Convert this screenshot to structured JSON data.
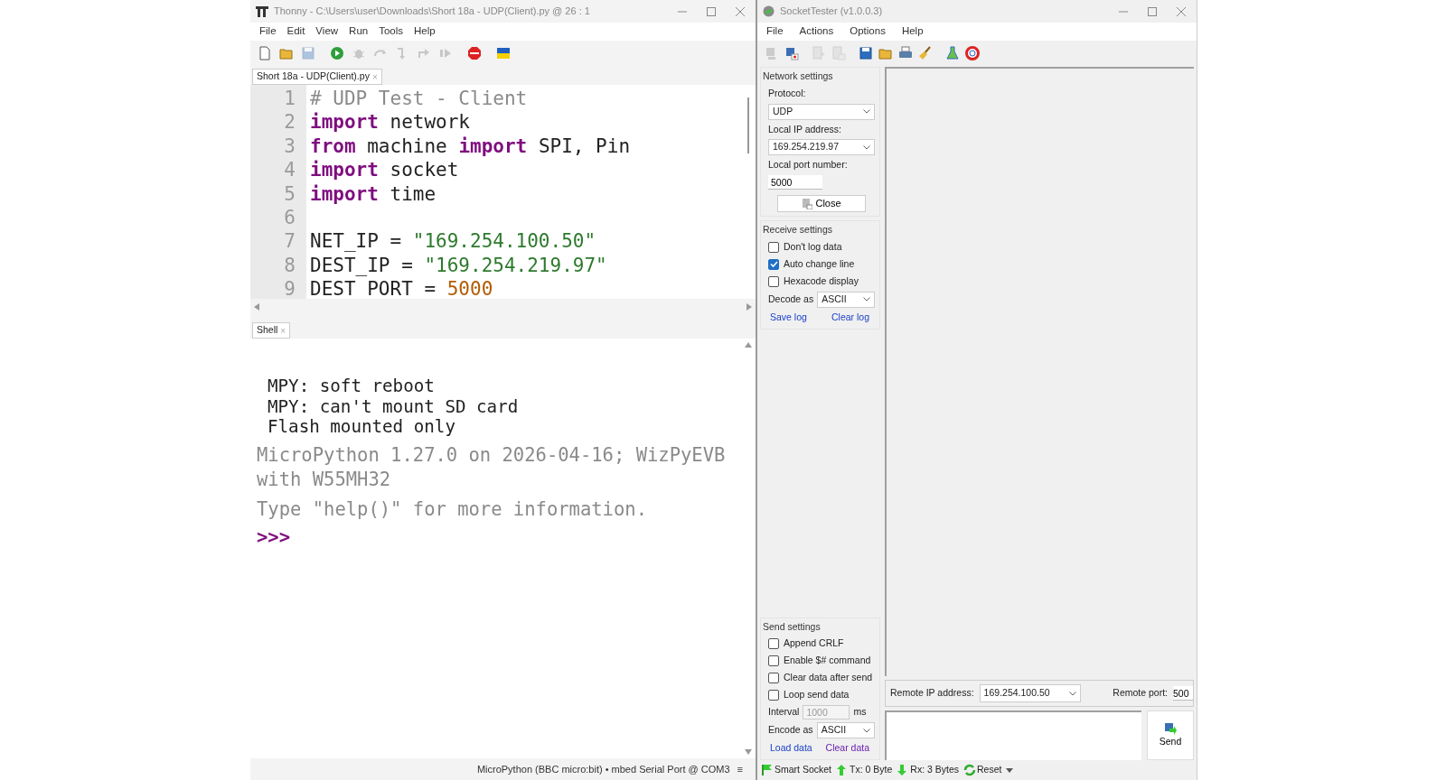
{
  "thonny": {
    "title": "Thonny  -  C:\\Users\\user\\Downloads\\Short 18a - UDP(Client).py  @  26 : 1",
    "menu": [
      "File",
      "Edit",
      "View",
      "Run",
      "Tools",
      "Help"
    ],
    "toolbar": [
      {
        "kind": "new",
        "disabled": false
      },
      {
        "kind": "open",
        "disabled": false
      },
      {
        "kind": "save",
        "disabled": true
      },
      {
        "kind": "run",
        "disabled": false
      },
      {
        "kind": "debug",
        "disabled": true
      },
      {
        "kind": "step-over",
        "disabled": true
      },
      {
        "kind": "step-into",
        "disabled": true
      },
      {
        "kind": "step-out",
        "disabled": true
      },
      {
        "kind": "resume",
        "disabled": true
      },
      {
        "kind": "stop",
        "disabled": false
      },
      {
        "kind": "flag",
        "disabled": false
      }
    ],
    "tabs": [
      {
        "label": "Short 18a - UDP(Client).py",
        "close": "×",
        "selected": true
      }
    ],
    "editor": {
      "lines": [
        {
          "number": "1",
          "tokens": [
            {
              "kind": "comment",
              "text": "# UDP Test - Client"
            }
          ]
        },
        {
          "number": "2",
          "tokens": [
            {
              "kind": "keyword",
              "text": "import"
            },
            {
              "kind": "plain",
              "text": " network"
            }
          ]
        },
        {
          "number": "3",
          "tokens": [
            {
              "kind": "keyword",
              "text": "from"
            },
            {
              "kind": "plain",
              "text": " machine "
            },
            {
              "kind": "keyword",
              "text": "import"
            },
            {
              "kind": "plain",
              "text": " SPI, Pin"
            }
          ]
        },
        {
          "number": "4",
          "tokens": [
            {
              "kind": "keyword",
              "text": "import"
            },
            {
              "kind": "plain",
              "text": " socket"
            }
          ]
        },
        {
          "number": "5",
          "tokens": [
            {
              "kind": "keyword",
              "text": "import"
            },
            {
              "kind": "plain",
              "text": " time"
            }
          ]
        },
        {
          "number": "6"
        },
        {
          "number": "7",
          "tokens": [
            {
              "kind": "plain",
              "text": "NET_IP = "
            },
            {
              "kind": "string",
              "text": "\"169.254.100.50\""
            }
          ]
        },
        {
          "number": "8",
          "tokens": [
            {
              "kind": "plain",
              "text": "DEST_IP = "
            },
            {
              "kind": "string",
              "text": "\"169.254.219.97\""
            }
          ]
        },
        {
          "number": "9",
          "tokens": [
            {
              "kind": "plain",
              "text": "DEST_PORT = "
            },
            {
              "kind": "number",
              "text": "5000"
            }
          ]
        }
      ]
    },
    "shell": {
      "tab": {
        "label": "Shell",
        "close": "×",
        "selected": true
      },
      "lines": [
        {
          "kind": "output",
          "text": "MPY: soft reboot"
        },
        {
          "kind": "output",
          "text": "MPY: can't mount SD card"
        },
        {
          "kind": "output",
          "text": "Flash mounted only"
        },
        {
          "kind": "banner",
          "text": "MicroPython 1.27.0 on 2026-04-16; WizPyEVB with W55MH32"
        },
        {
          "kind": "banner",
          "text": "Type \"help()\" for more information."
        },
        {
          "kind": "prompt",
          "text": ">>>"
        }
      ]
    },
    "status_bar": {
      "text": "MicroPython (BBC micro:bit)  •  mbed Serial Port @ COM3",
      "menu": "≡"
    }
  },
  "socket_tester": {
    "title": "SocketTester (v1.0.0.3)",
    "menu": [
      "File",
      "Actions",
      "Options",
      "Help"
    ],
    "toolbar": [
      {
        "kind": "connect",
        "disabled": true
      },
      {
        "kind": "disconnect",
        "disabled": false
      },
      {
        "kind": "send-file",
        "disabled": true
      },
      {
        "kind": "receive-file",
        "disabled": true
      },
      {
        "kind": "save",
        "disabled": false
      },
      {
        "kind": "open",
        "disabled": false
      },
      {
        "kind": "print",
        "disabled": false
      },
      {
        "kind": "clear",
        "disabled": false
      },
      {
        "kind": "test",
        "disabled": false
      },
      {
        "kind": "help",
        "disabled": false
      }
    ],
    "network": {
      "heading": "Network settings",
      "protocol_label": "Protocol:",
      "protocol": "UDP",
      "local_ip_label": "Local IP address:",
      "local_ip": "169.254.219.97",
      "local_port_label": "Local port number:",
      "local_port": "5000",
      "close_button": "Close"
    },
    "receive": {
      "heading": "Receive settings",
      "options": [
        {
          "label": "Don't log data",
          "checked": false
        },
        {
          "label": "Auto change line",
          "checked": true
        },
        {
          "label": "Hexacode display",
          "checked": false
        }
      ],
      "decode_label": "Decode as",
      "decode": "ASCII",
      "links": [
        {
          "label": "Save log",
          "visited": false
        },
        {
          "label": "Clear log",
          "visited": false
        }
      ]
    },
    "send": {
      "heading": "Send settings",
      "options": [
        {
          "label": "Append CRLF",
          "checked": false
        },
        {
          "label": "Enable $# command",
          "checked": false
        },
        {
          "label": "Clear data after send",
          "checked": false
        },
        {
          "label": "Loop send data",
          "checked": false
        }
      ],
      "interval_label": "Interval",
      "interval": "1000",
      "interval_disabled": true,
      "interval_unit": "ms",
      "encode_label": "Encode as",
      "encode": "ASCII",
      "links": [
        {
          "label": "Load data",
          "visited": false
        },
        {
          "label": "Clear data",
          "visited": true
        }
      ]
    },
    "remote": {
      "ip_label": "Remote IP address:",
      "ip": "169.254.100.50",
      "port_label": "Remote port:",
      "port": "500"
    },
    "send_button": "Send",
    "status_bar": [
      {
        "kind": "smart",
        "text": "Smart Socket"
      },
      {
        "kind": "tx",
        "text": "Tx: 0 Byte"
      },
      {
        "kind": "rx",
        "text": "Rx: 3 Bytes"
      },
      {
        "kind": "reset",
        "text": "Reset"
      }
    ]
  }
}
